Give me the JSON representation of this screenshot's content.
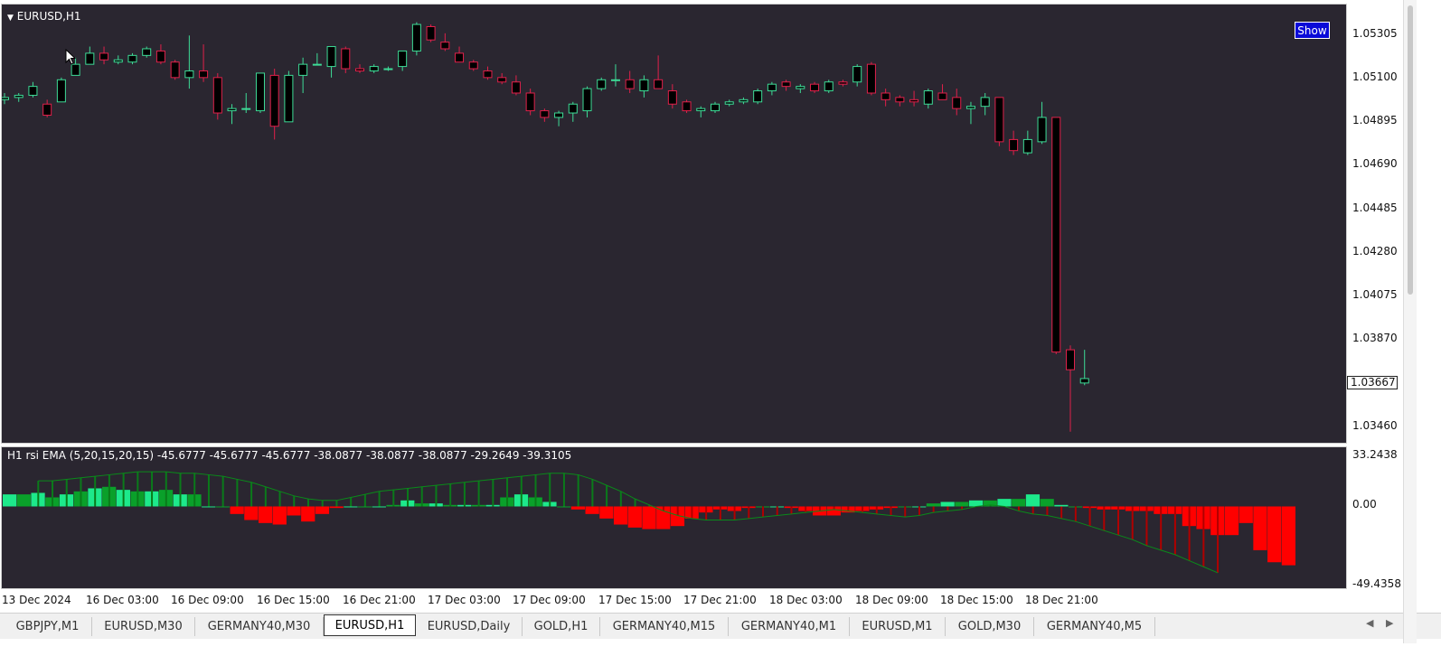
{
  "chart_title": "EURUSD,H1",
  "show_button": "Show",
  "price_axis": [
    "1.05305",
    "1.05100",
    "1.04895",
    "1.04690",
    "1.04485",
    "1.04280",
    "1.04075",
    "1.03870",
    "1.03460"
  ],
  "current_price": "1.03667",
  "indicator": {
    "title": "H1 rsi EMA (5,20,15,20,15) -45.6777 -45.6777 -45.6777 -38.0877 -38.0877 -38.0877 -29.2649 -39.3105",
    "axis_top": "33.2438",
    "axis_zero": "0.00",
    "axis_bottom": "-49.4358"
  },
  "time_axis": [
    "13 Dec 2024",
    "16 Dec 03:00",
    "16 Dec 09:00",
    "16 Dec 15:00",
    "16 Dec 21:00",
    "17 Dec 03:00",
    "17 Dec 09:00",
    "17 Dec 15:00",
    "17 Dec 21:00",
    "18 Dec 03:00",
    "18 Dec 09:00",
    "18 Dec 15:00",
    "18 Dec 21:00"
  ],
  "tabs": [
    {
      "label": "GBPJPY,M1",
      "active": false
    },
    {
      "label": "EURUSD,M30",
      "active": false
    },
    {
      "label": "GERMANY40,M30",
      "active": false
    },
    {
      "label": "EURUSD,H1",
      "active": true
    },
    {
      "label": "EURUSD,Daily",
      "active": false
    },
    {
      "label": "GOLD,H1",
      "active": false
    },
    {
      "label": "GERMANY40,M15",
      "active": false
    },
    {
      "label": "GERMANY40,M1",
      "active": false
    },
    {
      "label": "EURUSD,M1",
      "active": false
    },
    {
      "label": "GOLD,M30",
      "active": false
    },
    {
      "label": "GERMANY40,M5",
      "active": false
    }
  ],
  "colors": {
    "background": "#2a2630",
    "bull": "#3ddc97",
    "bear": "#e0204a",
    "hist_pos_light": "#1de98b",
    "hist_pos_dark": "#0aa02a",
    "hist_neg": "#ff0000",
    "hist_neg_dark": "#b00000"
  },
  "chart_data": {
    "type": "candlestick",
    "symbol": "EURUSD",
    "timeframe": "H1",
    "ylim": [
      1.0339,
      1.0537
    ],
    "ohlc": [
      {
        "o": 1.0494,
        "h": 1.0497,
        "l": 1.0492,
        "c": 1.0495
      },
      {
        "o": 1.0495,
        "h": 1.0497,
        "l": 1.0493,
        "c": 1.0496
      },
      {
        "o": 1.0496,
        "h": 1.0502,
        "l": 1.0495,
        "c": 1.05
      },
      {
        "o": 1.0492,
        "h": 1.0494,
        "l": 1.0486,
        "c": 1.0487
      },
      {
        "o": 1.0493,
        "h": 1.0504,
        "l": 1.0493,
        "c": 1.0503
      },
      {
        "o": 1.0505,
        "h": 1.0513,
        "l": 1.0505,
        "c": 1.051
      },
      {
        "o": 1.051,
        "h": 1.0518,
        "l": 1.051,
        "c": 1.0515
      },
      {
        "o": 1.0515,
        "h": 1.0518,
        "l": 1.051,
        "c": 1.0512
      },
      {
        "o": 1.0511,
        "h": 1.0514,
        "l": 1.051,
        "c": 1.0512
      },
      {
        "o": 1.0511,
        "h": 1.0515,
        "l": 1.051,
        "c": 1.0514
      },
      {
        "o": 1.0514,
        "h": 1.0518,
        "l": 1.0513,
        "c": 1.0517
      },
      {
        "o": 1.0516,
        "h": 1.0519,
        "l": 1.051,
        "c": 1.0511
      },
      {
        "o": 1.0511,
        "h": 1.0512,
        "l": 1.0503,
        "c": 1.0504
      },
      {
        "o": 1.0504,
        "h": 1.0523,
        "l": 1.0499,
        "c": 1.0507
      },
      {
        "o": 1.0507,
        "h": 1.0519,
        "l": 1.0502,
        "c": 1.0504
      },
      {
        "o": 1.0504,
        "h": 1.0506,
        "l": 1.0485,
        "c": 1.0488
      },
      {
        "o": 1.0489,
        "h": 1.0492,
        "l": 1.0483,
        "c": 1.049
      },
      {
        "o": 1.049,
        "h": 1.0497,
        "l": 1.0488,
        "c": 1.049
      },
      {
        "o": 1.0489,
        "h": 1.0506,
        "l": 1.0488,
        "c": 1.0506
      },
      {
        "o": 1.0505,
        "h": 1.0508,
        "l": 1.0476,
        "c": 1.0482
      },
      {
        "o": 1.0484,
        "h": 1.0507,
        "l": 1.0484,
        "c": 1.0505
      },
      {
        "o": 1.0505,
        "h": 1.0513,
        "l": 1.0497,
        "c": 1.051
      },
      {
        "o": 1.051,
        "h": 1.0515,
        "l": 1.051,
        "c": 1.051
      },
      {
        "o": 1.0509,
        "h": 1.0517,
        "l": 1.0504,
        "c": 1.0518
      },
      {
        "o": 1.0517,
        "h": 1.0518,
        "l": 1.0506,
        "c": 1.0508
      },
      {
        "o": 1.0508,
        "h": 1.051,
        "l": 1.0506,
        "c": 1.0507
      },
      {
        "o": 1.0507,
        "h": 1.051,
        "l": 1.0506,
        "c": 1.0509
      },
      {
        "o": 1.0508,
        "h": 1.0509,
        "l": 1.0507,
        "c": 1.0508
      },
      {
        "o": 1.0509,
        "h": 1.0516,
        "l": 1.0507,
        "c": 1.0516
      },
      {
        "o": 1.0516,
        "h": 1.0529,
        "l": 1.0514,
        "c": 1.0528
      },
      {
        "o": 1.0527,
        "h": 1.0528,
        "l": 1.052,
        "c": 1.0521
      },
      {
        "o": 1.052,
        "h": 1.0524,
        "l": 1.0516,
        "c": 1.0517
      },
      {
        "o": 1.0515,
        "h": 1.0518,
        "l": 1.0511,
        "c": 1.0511
      },
      {
        "o": 1.0511,
        "h": 1.0512,
        "l": 1.0507,
        "c": 1.0508
      },
      {
        "o": 1.0507,
        "h": 1.0509,
        "l": 1.0503,
        "c": 1.0504
      },
      {
        "o": 1.0504,
        "h": 1.0506,
        "l": 1.0501,
        "c": 1.0502
      },
      {
        "o": 1.0502,
        "h": 1.0505,
        "l": 1.0496,
        "c": 1.0497
      },
      {
        "o": 1.0497,
        "h": 1.0499,
        "l": 1.0487,
        "c": 1.0489
      },
      {
        "o": 1.0489,
        "h": 1.049,
        "l": 1.0484,
        "c": 1.0486
      },
      {
        "o": 1.0486,
        "h": 1.0489,
        "l": 1.0482,
        "c": 1.0488
      },
      {
        "o": 1.0488,
        "h": 1.0493,
        "l": 1.0484,
        "c": 1.0492
      },
      {
        "o": 1.0489,
        "h": 1.05,
        "l": 1.0486,
        "c": 1.0499
      },
      {
        "o": 1.0499,
        "h": 1.0504,
        "l": 1.0498,
        "c": 1.0503
      },
      {
        "o": 1.0503,
        "h": 1.051,
        "l": 1.05,
        "c": 1.0503
      },
      {
        "o": 1.0503,
        "h": 1.0507,
        "l": 1.0497,
        "c": 1.0499
      },
      {
        "o": 1.0498,
        "h": 1.0505,
        "l": 1.0495,
        "c": 1.0503
      },
      {
        "o": 1.0503,
        "h": 1.0514,
        "l": 1.0501,
        "c": 1.0499
      },
      {
        "o": 1.0498,
        "h": 1.0501,
        "l": 1.049,
        "c": 1.0492
      },
      {
        "o": 1.0493,
        "h": 1.0494,
        "l": 1.0488,
        "c": 1.0489
      },
      {
        "o": 1.0489,
        "h": 1.0491,
        "l": 1.0486,
        "c": 1.049
      },
      {
        "o": 1.0489,
        "h": 1.0493,
        "l": 1.0488,
        "c": 1.0492
      },
      {
        "o": 1.0492,
        "h": 1.0494,
        "l": 1.0491,
        "c": 1.0493
      },
      {
        "o": 1.0493,
        "h": 1.0495,
        "l": 1.0492,
        "c": 1.0494
      },
      {
        "o": 1.0493,
        "h": 1.0499,
        "l": 1.0492,
        "c": 1.0498
      },
      {
        "o": 1.0498,
        "h": 1.0502,
        "l": 1.0496,
        "c": 1.0501
      },
      {
        "o": 1.0502,
        "h": 1.0503,
        "l": 1.0498,
        "c": 1.05
      },
      {
        "o": 1.0499,
        "h": 1.0501,
        "l": 1.0497,
        "c": 1.05
      },
      {
        "o": 1.0501,
        "h": 1.0502,
        "l": 1.0497,
        "c": 1.0498
      },
      {
        "o": 1.0498,
        "h": 1.0503,
        "l": 1.0497,
        "c": 1.0502
      },
      {
        "o": 1.0502,
        "h": 1.0503,
        "l": 1.05,
        "c": 1.0501
      },
      {
        "o": 1.0502,
        "h": 1.051,
        "l": 1.05,
        "c": 1.0509
      },
      {
        "o": 1.051,
        "h": 1.0511,
        "l": 1.0496,
        "c": 1.0497
      },
      {
        "o": 1.0497,
        "h": 1.0499,
        "l": 1.0491,
        "c": 1.0494
      },
      {
        "o": 1.0495,
        "h": 1.0496,
        "l": 1.0491,
        "c": 1.0493
      },
      {
        "o": 1.0494,
        "h": 1.0498,
        "l": 1.0491,
        "c": 1.0493
      },
      {
        "o": 1.0492,
        "h": 1.0499,
        "l": 1.049,
        "c": 1.0498
      },
      {
        "o": 1.0497,
        "h": 1.0501,
        "l": 1.0495,
        "c": 1.0494
      },
      {
        "o": 1.0495,
        "h": 1.0499,
        "l": 1.0487,
        "c": 1.049
      },
      {
        "o": 1.049,
        "h": 1.0493,
        "l": 1.0483,
        "c": 1.0491
      },
      {
        "o": 1.0491,
        "h": 1.0497,
        "l": 1.0487,
        "c": 1.0495
      },
      {
        "o": 1.0495,
        "h": 1.0495,
        "l": 1.0473,
        "c": 1.0475
      },
      {
        "o": 1.0476,
        "h": 1.048,
        "l": 1.0469,
        "c": 1.0471
      },
      {
        "o": 1.047,
        "h": 1.048,
        "l": 1.0469,
        "c": 1.0476
      },
      {
        "o": 1.0475,
        "h": 1.0493,
        "l": 1.0474,
        "c": 1.0486
      },
      {
        "o": 1.0486,
        "h": 1.0486,
        "l": 1.0379,
        "c": 1.038
      },
      {
        "o": 1.0381,
        "h": 1.0383,
        "l": 1.0344,
        "c": 1.0372
      },
      {
        "o": 1.0366,
        "h": 1.0381,
        "l": 1.0365,
        "c": 1.0368
      }
    ],
    "indicator_name": "rsi EMA (5,20,15,20,15)",
    "indicator_ylim": [
      -49.4358,
      33.2438
    ],
    "hist": [
      8,
      8,
      9,
      6,
      8,
      10,
      12,
      13,
      11,
      10,
      10,
      11,
      8,
      8,
      0,
      0,
      -5,
      -9,
      -11,
      -12,
      -6,
      -10,
      -5,
      -1,
      0,
      0,
      0,
      1,
      4,
      2,
      2,
      1,
      1,
      1,
      1,
      6,
      8,
      6,
      3,
      0,
      -2,
      -5,
      -8,
      -12,
      -14,
      -15,
      -15,
      -13,
      -8,
      -4,
      -2,
      -3,
      -1,
      0,
      0,
      -1,
      -3,
      -6,
      -6,
      -4,
      -3,
      -2,
      -1,
      0,
      0,
      2,
      3,
      3,
      4,
      4,
      5,
      5,
      8,
      5,
      1,
      0,
      -1,
      -2,
      -2,
      -3,
      -3,
      -5,
      -5,
      -13,
      -15,
      -19,
      -19,
      -11,
      -29,
      -37,
      -39
    ],
    "ema_line": [
      17,
      17,
      18,
      19,
      20,
      21,
      22,
      23,
      23,
      23,
      22,
      22,
      21,
      20,
      18,
      16,
      13,
      10,
      7,
      5,
      4,
      4,
      6,
      8,
      10,
      11,
      12,
      13,
      14,
      15,
      16,
      17,
      18,
      19,
      20,
      21,
      22,
      22,
      21,
      18,
      14,
      10,
      5,
      1,
      -3,
      -6,
      -8,
      -9,
      -9,
      -9,
      -8,
      -7,
      -6,
      -5,
      -4,
      -3,
      -2,
      -3,
      -4,
      -5,
      -6,
      -7,
      -6,
      -4,
      -3,
      -2,
      0,
      1,
      0,
      -3,
      -5,
      -6,
      -8,
      -10,
      -13,
      -16,
      -19,
      -22,
      -26,
      -29,
      -32,
      -36,
      -40,
      -44
    ]
  }
}
